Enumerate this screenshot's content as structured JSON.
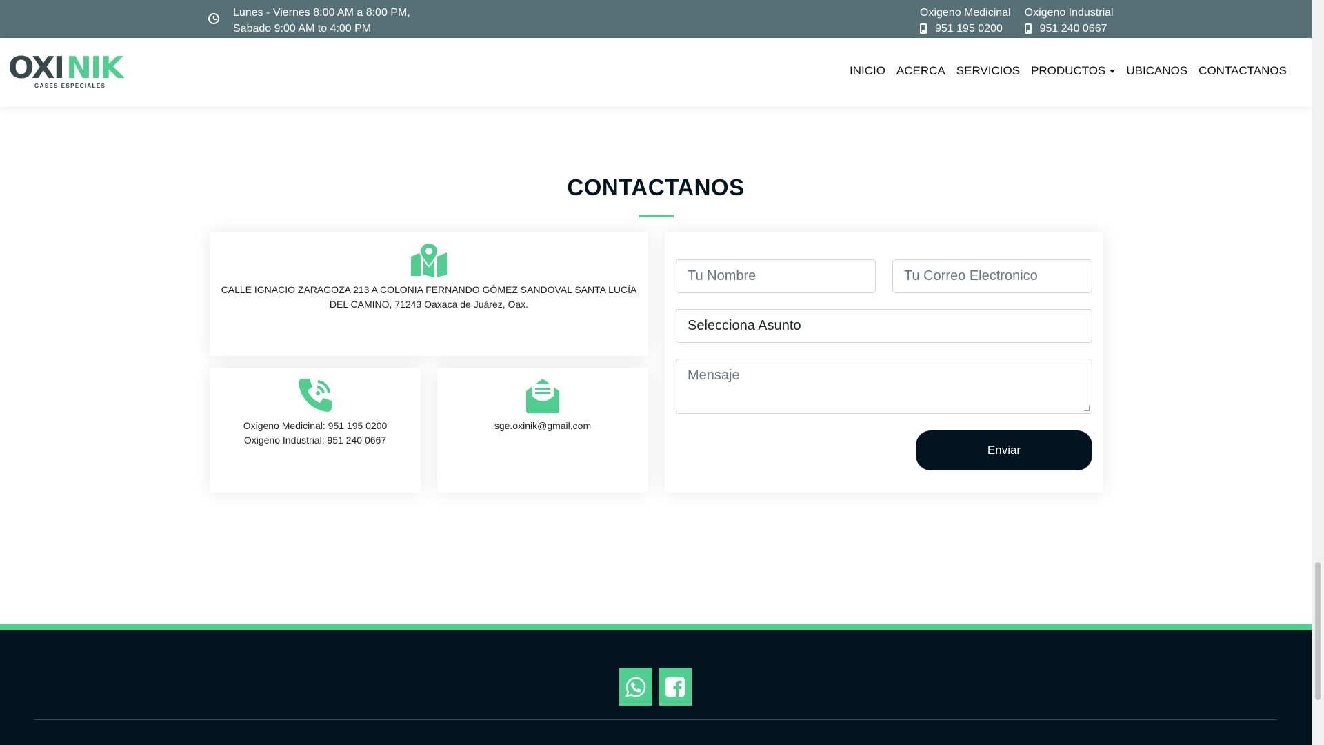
{
  "topbar": {
    "hours_line1": "Lunes - Viernes 8:00 AM a 8:00 PM,",
    "hours_line2": "Sabado 9:00 AM to 4:00 PM",
    "phones": [
      {
        "label": "Oxigeno Medicinal",
        "number": "951 195 0200"
      },
      {
        "label": "Oxigeno Industrial",
        "number": "951 240 0667"
      }
    ]
  },
  "header": {
    "logo_left": "OXI",
    "logo_right": "NIK",
    "logo_tagline": "GASES ESPECIALES",
    "nav": [
      "INICIO",
      "ACERCA",
      "SERVICIOS",
      "PRODUCTOS",
      "UBICANOS",
      "CONTACTANOS"
    ]
  },
  "contact": {
    "title": "CONTACTANOS",
    "address": "CALLE IGNACIO ZARAGOZA 213 A COLONIA FERNANDO GÓMEZ SANDOVAL SANTA LUCÍA DEL CAMINO, 71243 Oaxaca de Juárez, Oax.",
    "phone_medicinal": "Oxigeno Medicinal: 951 195 0200",
    "phone_industrial": "Oxigeno Industrial: 951 240 0667",
    "email": "sge.oxinik@gmail.com"
  },
  "form": {
    "name_placeholder": "Tu Nombre",
    "email_placeholder": "Tu Correo Electronico",
    "subject_selected": "Selecciona Asunto",
    "message_placeholder": "Mensaje",
    "submit_label": "Enviar"
  },
  "colors": {
    "accent": "#4fce8f",
    "topbar": "#567076",
    "dark": "#01141f"
  },
  "footer": {
    "social_icons": [
      "whatsapp-icon",
      "facebook-icon"
    ]
  }
}
